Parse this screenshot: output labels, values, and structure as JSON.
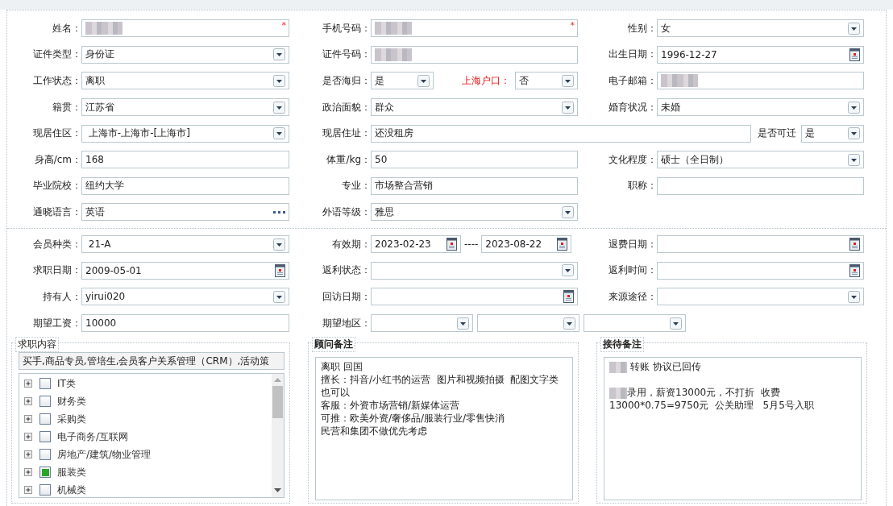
{
  "section_1": [
    {
      "columns": [
        {
          "parts": [
            {
              "kind": "label",
              "text": "姓名："
            },
            {
              "kind": "redacted",
              "required_mark": "*"
            }
          ]
        },
        {
          "parts": [
            {
              "kind": "label",
              "text": "手机号码："
            },
            {
              "kind": "redacted",
              "required_mark": "*"
            }
          ]
        },
        {
          "parts": [
            {
              "kind": "label",
              "text": "性别："
            },
            {
              "kind": "select",
              "value": "女"
            }
          ]
        }
      ]
    },
    {
      "columns": [
        {
          "parts": [
            {
              "kind": "label",
              "text": "证件类型："
            },
            {
              "kind": "select",
              "value": "身份证"
            }
          ]
        },
        {
          "parts": [
            {
              "kind": "label",
              "text": "证件号码："
            },
            {
              "kind": "redacted"
            }
          ]
        },
        {
          "parts": [
            {
              "kind": "label",
              "text": "出生日期："
            },
            {
              "kind": "date",
              "value": "1996-12-27"
            }
          ]
        }
      ]
    },
    {
      "columns": [
        {
          "parts": [
            {
              "kind": "label",
              "text": "工作状态："
            },
            {
              "kind": "select",
              "value": "离职"
            }
          ]
        },
        {
          "parts": [
            {
              "kind": "label",
              "text": "是否海归："
            },
            {
              "kind": "select",
              "value": "是"
            },
            {
              "kind": "label",
              "text": "上海户口：",
              "emphasis": true
            },
            {
              "kind": "select",
              "value": "否"
            }
          ]
        },
        {
          "parts": [
            {
              "kind": "label",
              "text": "电子邮箱："
            },
            {
              "kind": "redacted"
            }
          ]
        }
      ]
    },
    {
      "columns": [
        {
          "parts": [
            {
              "kind": "label",
              "text": "籍贯："
            },
            {
              "kind": "select",
              "value": "江苏省"
            }
          ]
        },
        {
          "parts": [
            {
              "kind": "label",
              "text": "政治面貌："
            },
            {
              "kind": "select",
              "value": "群众"
            }
          ]
        },
        {
          "parts": [
            {
              "kind": "label",
              "text": "婚育状况："
            },
            {
              "kind": "select",
              "value": "未婚"
            }
          ]
        }
      ]
    },
    {
      "columns": [
        {
          "parts": [
            {
              "kind": "label",
              "text": "现居住区："
            },
            {
              "kind": "select",
              "value": " 上海市-上海市-[上海市]"
            }
          ]
        },
        {
          "parts": [
            {
              "kind": "label",
              "text": "现居住址："
            },
            {
              "kind": "text",
              "value": "还没租房"
            },
            {
              "kind": "label",
              "text": "是否可迁"
            },
            {
              "kind": "select",
              "value": "是"
            }
          ]
        }
      ]
    },
    {
      "columns": [
        {
          "parts": [
            {
              "kind": "label",
              "text": "身高/cm："
            },
            {
              "kind": "text",
              "value": "168"
            }
          ]
        },
        {
          "parts": [
            {
              "kind": "label",
              "text": "体重/kg："
            },
            {
              "kind": "text",
              "value": "50"
            }
          ]
        },
        {
          "parts": [
            {
              "kind": "label",
              "text": "文化程度："
            },
            {
              "kind": "select",
              "value": "硕士（全日制）"
            }
          ]
        }
      ]
    },
    {
      "columns": [
        {
          "parts": [
            {
              "kind": "label",
              "text": "毕业院校："
            },
            {
              "kind": "text",
              "value": "纽约大学"
            }
          ]
        },
        {
          "parts": [
            {
              "kind": "label",
              "text": "专业："
            },
            {
              "kind": "text",
              "value": "市场整合营销"
            }
          ]
        },
        {
          "parts": [
            {
              "kind": "label",
              "text": "职称："
            },
            {
              "kind": "text"
            }
          ]
        }
      ]
    },
    {
      "columns": [
        {
          "parts": [
            {
              "kind": "label",
              "text": "通晓语言："
            },
            {
              "kind": "lookup",
              "value": "英语"
            }
          ]
        },
        {
          "parts": [
            {
              "kind": "label",
              "text": "外语等级："
            },
            {
              "kind": "select",
              "value": "雅思"
            }
          ]
        }
      ]
    }
  ],
  "section_2": [
    {
      "columns": [
        {
          "parts": [
            {
              "kind": "label",
              "text": "会员种类："
            },
            {
              "kind": "select",
              "value": " 21-A"
            }
          ]
        },
        {
          "parts": [
            {
              "kind": "label",
              "text": "有效期："
            },
            {
              "kind": "date",
              "value": "2023-02-23"
            },
            {
              "kind": "separator",
              "text": "----"
            },
            {
              "kind": "date",
              "value": "2023-08-22"
            }
          ]
        },
        {
          "parts": [
            {
              "kind": "label",
              "text": "退费日期："
            },
            {
              "kind": "date"
            }
          ]
        }
      ]
    },
    {
      "columns": [
        {
          "parts": [
            {
              "kind": "label",
              "text": "求职日期："
            },
            {
              "kind": "date",
              "value": "2009-05-01"
            }
          ]
        },
        {
          "parts": [
            {
              "kind": "label",
              "text": "返利状态："
            },
            {
              "kind": "select"
            }
          ]
        },
        {
          "parts": [
            {
              "kind": "label",
              "text": "返利时间："
            },
            {
              "kind": "date"
            }
          ]
        }
      ]
    },
    {
      "columns": [
        {
          "parts": [
            {
              "kind": "label",
              "text": "持有人："
            },
            {
              "kind": "select",
              "value": "yirui020"
            }
          ]
        },
        {
          "parts": [
            {
              "kind": "label",
              "text": "回访日期："
            },
            {
              "kind": "date"
            }
          ]
        },
        {
          "parts": [
            {
              "kind": "label",
              "text": "来源途径："
            },
            {
              "kind": "select"
            }
          ]
        }
      ]
    },
    {
      "columns": [
        {
          "parts": [
            {
              "kind": "label",
              "text": "期望工资："
            },
            {
              "kind": "text",
              "value": "10000"
            }
          ]
        },
        {
          "parts": [
            {
              "kind": "label",
              "text": "期望地区："
            },
            {
              "kind": "select"
            },
            {
              "kind": "select"
            },
            {
              "kind": "select"
            }
          ]
        }
      ]
    }
  ],
  "job_panel": {
    "title": "求职内容",
    "selected_jobs": "买手,商品专员,管培生,会员客户关系管理（CRM）,活动策",
    "tree": [
      {
        "label": "IT类",
        "checked": false,
        "expanded": false
      },
      {
        "label": "财务类",
        "checked": false,
        "expanded": false
      },
      {
        "label": "采购类",
        "checked": false,
        "expanded": false
      },
      {
        "label": "电子商务/互联网",
        "checked": false,
        "expanded": false
      },
      {
        "label": "房地产/建筑/物业管理",
        "checked": false,
        "expanded": false
      },
      {
        "label": "服装类",
        "checked": true,
        "expanded": false
      },
      {
        "label": "机械类",
        "checked": false,
        "expanded": false
      }
    ]
  },
  "notes": [
    {
      "title": "顾问备注",
      "lines": [
        {
          "kind": "line",
          "text": "离职 回国"
        },
        {
          "kind": "line",
          "text": "擅长：抖音/小红书的运营  图片和视频拍摄  配图文字类也可以"
        },
        {
          "kind": "line",
          "text": "客服：外资市场营销/新媒体运营"
        },
        {
          "kind": "line",
          "text": "可推：欧美外资/奢侈品/服装行业/零售快消"
        },
        {
          "kind": "line",
          "text": "民营和集团不做优先考虑"
        }
      ]
    },
    {
      "title": "接待备注",
      "lines": [
        {
          "kind": "redacted_line",
          "text": " 转账 协议已回传"
        },
        {
          "kind": "blank"
        },
        {
          "kind": "redacted_line",
          "text": "录用，薪资13000元，不打折  收费"
        },
        {
          "kind": "line",
          "text": "13000*0.75=9750元  公关助理   5月5号入职"
        }
      ]
    }
  ]
}
